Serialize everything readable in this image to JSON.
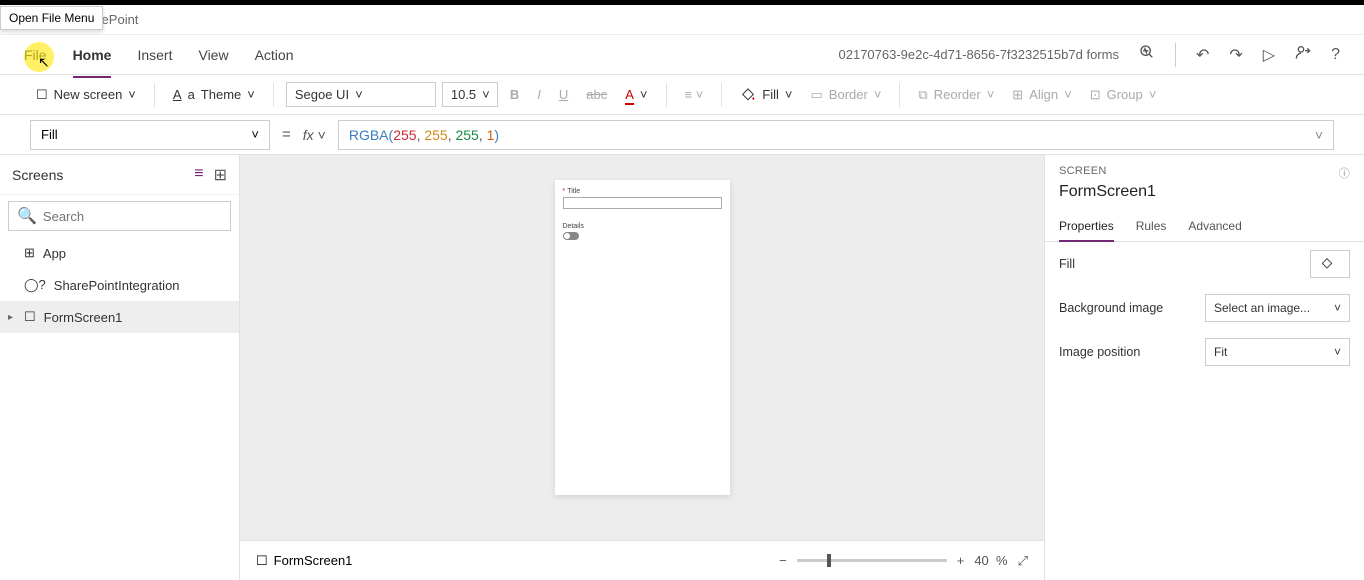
{
  "tooltip": "Open File Menu",
  "app_title": "arePoint",
  "menubar": {
    "file": "File",
    "home": "Home",
    "insert": "Insert",
    "view": "View",
    "action": "Action",
    "doc_title": "02170763-9e2c-4d71-8656-7f3232515b7d forms"
  },
  "toolbar": {
    "new_screen": "New screen",
    "theme": "Theme",
    "font": "Segoe UI",
    "font_size": "10.5",
    "fill": "Fill",
    "border": "Border",
    "reorder": "Reorder",
    "align": "Align",
    "group": "Group"
  },
  "formula": {
    "property": "Fill",
    "fn": "RGBA",
    "a1": "255",
    "a2": "255",
    "a3": "255",
    "a4": "1"
  },
  "left_panel": {
    "title": "Screens",
    "search_placeholder": "Search",
    "items": {
      "app": "App",
      "spi": "SharePointIntegration",
      "fs": "FormScreen1"
    }
  },
  "form_preview": {
    "title_label": "Title",
    "details_label": "Details"
  },
  "right_panel": {
    "category": "SCREEN",
    "object": "FormScreen1",
    "tabs": {
      "properties": "Properties",
      "rules": "Rules",
      "advanced": "Advanced"
    },
    "props": {
      "fill": "Fill",
      "bg_image": "Background image",
      "bg_image_value": "Select an image...",
      "img_pos": "Image position",
      "img_pos_value": "Fit"
    }
  },
  "status": {
    "crumb": "FormScreen1",
    "zoom": "40",
    "zoom_unit": "%"
  }
}
